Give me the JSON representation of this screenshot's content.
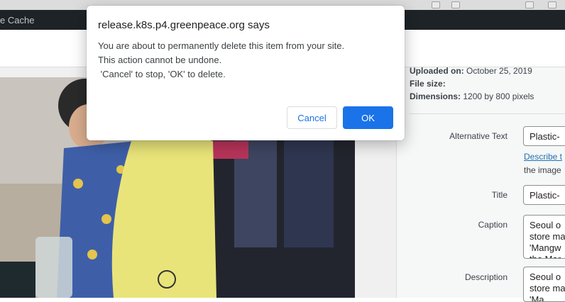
{
  "admin_bar": {
    "cache_label": "e Cache"
  },
  "attachment": {
    "uploaded_label": "Uploaded on:",
    "uploaded_value": "October 25, 2019",
    "filesize_label": "File size:",
    "filesize_value": "",
    "dimensions_label": "Dimensions:",
    "dimensions_value": "1200 by 800 pixels"
  },
  "fields": {
    "alt_label": "Alternative Text",
    "alt_value": "Plastic-",
    "describe_link": "Describe t",
    "describe_rest": "the image",
    "title_label": "Title",
    "title_value": "Plastic-",
    "caption_label": "Caption",
    "caption_value": "Seoul o\nstore ma\n'Mangw\nthe Mar",
    "description_label": "Description",
    "description_value": "Seoul o\nstore ma\n'Ma"
  },
  "dialog": {
    "title": "release.k8s.p4.greenpeace.org says",
    "line1": "You are about to permanently delete this item from your site.",
    "line2": "This action cannot be undone.",
    "line3": " 'Cancel' to stop, 'OK' to delete.",
    "cancel_label": "Cancel",
    "ok_label": "OK"
  },
  "colors": {
    "admin_bar": "#1d2327",
    "link": "#2271b1",
    "dialog_button": "#1a73e8"
  }
}
